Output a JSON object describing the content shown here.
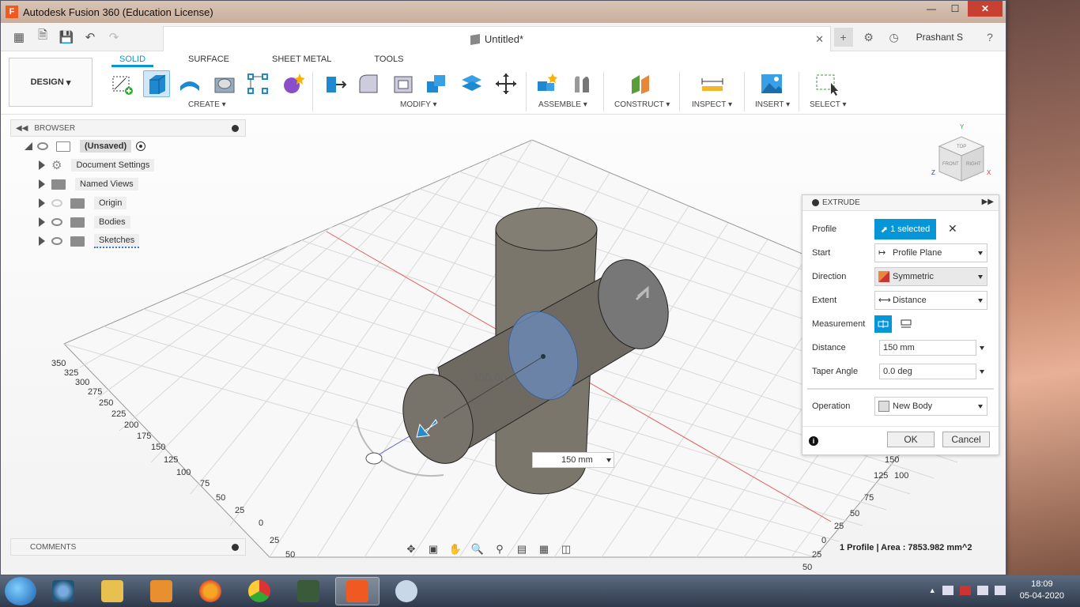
{
  "window": {
    "title": "Autodesk Fusion 360 (Education License)",
    "logo": "F"
  },
  "qat": {
    "doc_title": "Untitled*",
    "user": "Prashant S"
  },
  "ribbon": {
    "workspace": "DESIGN",
    "tabs": [
      "SOLID",
      "SURFACE",
      "SHEET METAL",
      "TOOLS"
    ],
    "groups": [
      "CREATE",
      "MODIFY",
      "ASSEMBLE",
      "CONSTRUCT",
      "INSPECT",
      "INSERT",
      "SELECT"
    ]
  },
  "browser": {
    "title": "BROWSER",
    "root": "(Unsaved)",
    "items": [
      "Document Settings",
      "Named Views",
      "Origin",
      "Bodies",
      "Sketches"
    ]
  },
  "comments": {
    "title": "COMMENTS"
  },
  "viewcube": {
    "top": "TOP",
    "front": "FRONT",
    "right": "RIGHT",
    "x": "X",
    "y": "Y",
    "z": "Z"
  },
  "extrude": {
    "title": "EXTRUDE",
    "profile_label": "Profile",
    "profile_value": "1 selected",
    "start_label": "Start",
    "start_value": "Profile Plane",
    "direction_label": "Direction",
    "direction_value": "Symmetric",
    "extent_label": "Extent",
    "extent_value": "Distance",
    "measurement_label": "Measurement",
    "distance_label": "Distance",
    "distance_value": "150 mm",
    "taper_label": "Taper Angle",
    "taper_value": "0.0 deg",
    "operation_label": "Operation",
    "operation_value": "New Body",
    "ok": "OK",
    "cancel": "Cancel"
  },
  "canvas": {
    "dimension_label": "150.00",
    "distance_field": "150 mm",
    "ruler_left": [
      "350",
      "325",
      "300",
      "275",
      "250",
      "225",
      "200",
      "175",
      "150",
      "125",
      "100",
      "75",
      "50",
      "25",
      "0",
      "25",
      "50"
    ],
    "ruler_right": [
      "150",
      "125",
      "100",
      "75",
      "50",
      "25",
      "0",
      "25",
      "50"
    ]
  },
  "status": {
    "text": "1 Profile | Area : 7853.982 mm^2"
  },
  "taskbar": {
    "time": "18:09",
    "date": "05-04-2020"
  }
}
